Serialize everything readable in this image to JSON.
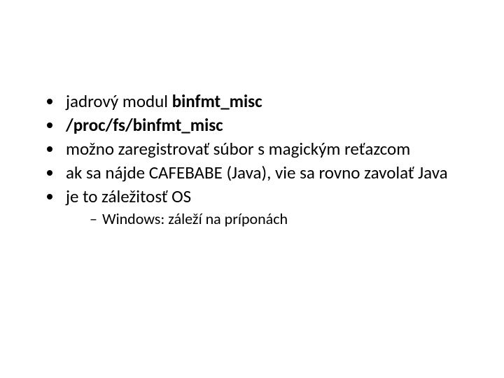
{
  "bullets": {
    "b1_prefix": "jadrový modul ",
    "b1_bold": "binfmt_misc",
    "b2_bold": "/proc/fs/binfmt_misc",
    "b3": "možno zaregistrovať súbor s magickým reťazcom",
    "b4": "ak sa nájde CAFEBABE (Java), vie sa rovno zavolať Java",
    "b5": "je to záležitosť OS",
    "b5_sub1": "Windows: záleží na príponách"
  }
}
